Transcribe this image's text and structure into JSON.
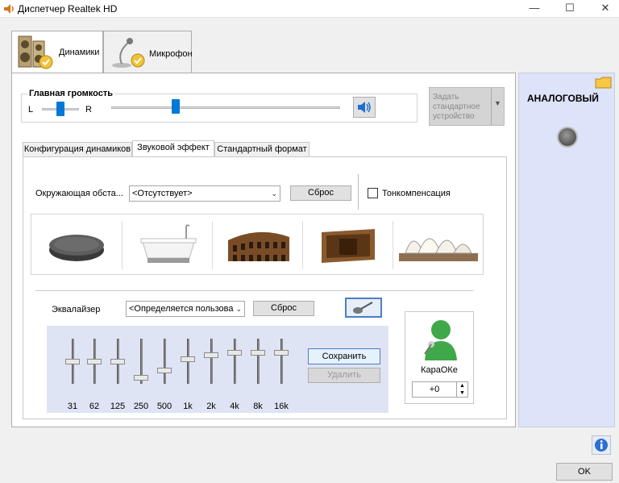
{
  "window": {
    "title": "Диспетчер Realtek HD",
    "minimize": "—",
    "maximize": "☐",
    "close": "✕"
  },
  "device_tabs": [
    {
      "label": "Динамики"
    },
    {
      "label": "Микрофон"
    }
  ],
  "master_volume": {
    "label": "Главная громкость",
    "left": "L",
    "right": "R",
    "balance": 0.5,
    "level": 0.28
  },
  "default_device": {
    "label": "Задать стандартное устройство"
  },
  "sub_tabs": [
    {
      "label": "Конфигурация динамиков"
    },
    {
      "label": "Звуковой эффект"
    },
    {
      "label": "Стандартный формат"
    }
  ],
  "environment": {
    "label": "Окружающая обста...",
    "value": "<Отсутствует>",
    "reset": "Сброс"
  },
  "loudness": {
    "label": "Тонкомпенсация",
    "checked": false
  },
  "equalizer": {
    "label": "Эквалайзер",
    "preset": "<Определяется пользова",
    "reset": "Сброс",
    "save": "Сохранить",
    "delete": "Удалить",
    "bands": [
      {
        "label": "31",
        "level": 0.5
      },
      {
        "label": "62",
        "level": 0.5
      },
      {
        "label": "125",
        "level": 0.5
      },
      {
        "label": "250",
        "level": 0.15
      },
      {
        "label": "500",
        "level": 0.3
      },
      {
        "label": "1k",
        "level": 0.55
      },
      {
        "label": "2k",
        "level": 0.65
      },
      {
        "label": "4k",
        "level": 0.7
      },
      {
        "label": "8k",
        "level": 0.7
      },
      {
        "label": "16k",
        "level": 0.7
      }
    ]
  },
  "karaoke": {
    "label": "КараОКе",
    "value": "+0"
  },
  "connector": {
    "label": "АНАЛОГОВЫЙ"
  },
  "ok_button": "OK"
}
